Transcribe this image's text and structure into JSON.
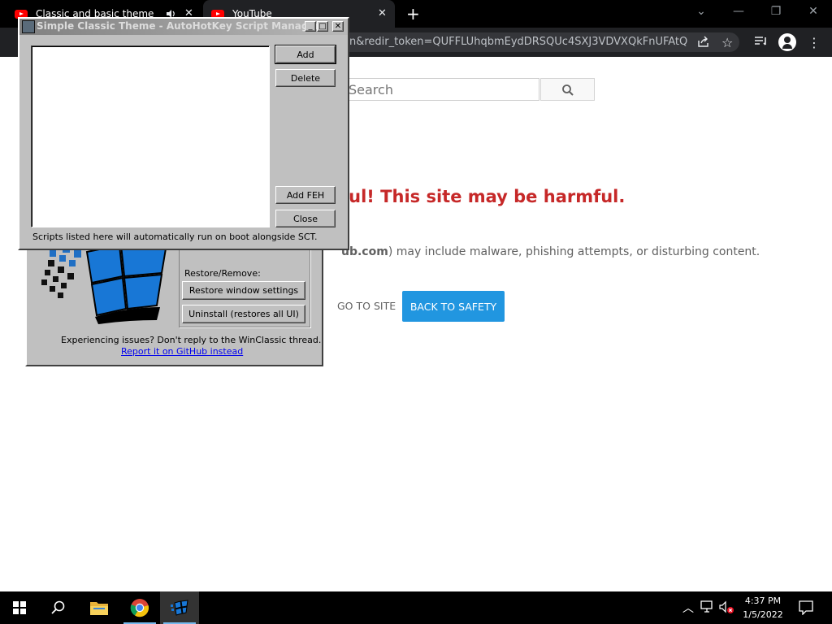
{
  "browser": {
    "tabs": [
      {
        "title": "Classic and basic theme on W",
        "active": false
      },
      {
        "title": "YouTube",
        "active": true
      }
    ],
    "new_tab_glyph": "+",
    "url": "n&redir_token=QUFFLUhqbmEydDRSQUc4SXJ3VDVXQkFnUFAtQ..."
  },
  "page": {
    "search_placeholder": "Search",
    "warning_title": "ful! This site may be harmful.",
    "warning_desc_bold": "ub.com",
    "warning_desc": ") may include malware, phishing attempts, or disturbing content.",
    "go_to_site": "GO TO SITE",
    "back_to_safety": "BACK TO SAFETY",
    "accent_color": "#2196e0",
    "warning_color": "#c62828"
  },
  "manager": {
    "title": "Simple Classic Theme - AutoHotKey Script Manager",
    "buttons": {
      "add": "Add",
      "delete": "Delete",
      "add_feh": "Add FEH",
      "close": "Close"
    },
    "footer": "Scripts listed here will automatically run on boot alongside SCT."
  },
  "sct": {
    "restore_label": "Restore/Remove:",
    "restore_button": "Restore window settings",
    "uninstall_button": "Uninstall (restores all UI)",
    "issue_text": "Experiencing issues? Don't reply to the WinClassic thread.",
    "github_link": "Report it on GitHub instead"
  },
  "taskbar": {
    "time": "4:37 PM",
    "date": "1/5/2022",
    "apps": [
      "file-explorer",
      "chrome",
      "simple-classic-theme"
    ]
  }
}
